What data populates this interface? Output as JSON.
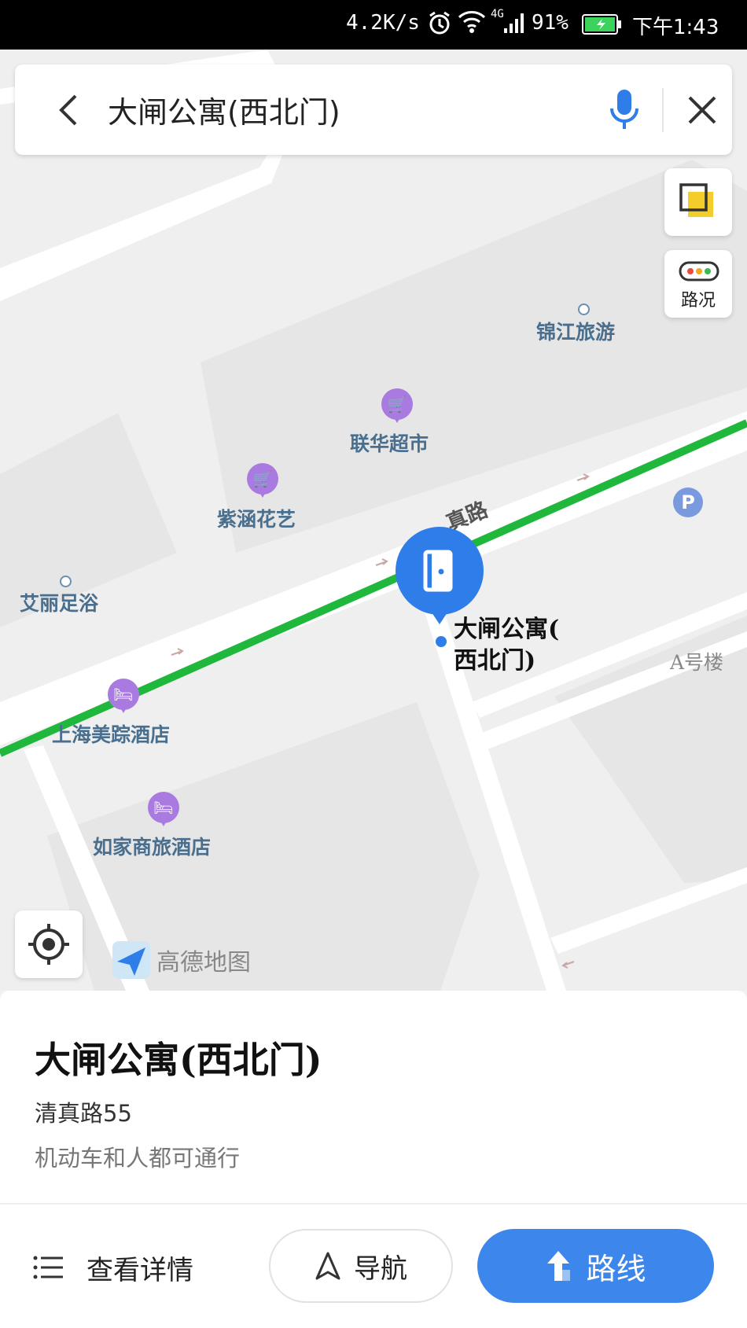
{
  "status_bar": {
    "speed": "4.2K/s",
    "network": "4G",
    "battery": "91%",
    "time": "下午1:43"
  },
  "search": {
    "query": "大闸公寓(西北门)",
    "back_icon": "chevron-left-icon",
    "mic_icon": "microphone-icon",
    "close_icon": "close-icon"
  },
  "map": {
    "layer_icon": "layers-icon",
    "traffic_label": "路况",
    "road_fragment": "真路",
    "pois": {
      "jinjiang": "锦江旅游",
      "lianhua": "联华超市",
      "zihan": "紫涵花艺",
      "aili": "艾丽足浴",
      "shanghai_hotel": "上海美踪酒店",
      "rujia": "如家商旅酒店",
      "building_a": "A号楼"
    },
    "selected_label_line1": "大闸公寓(",
    "selected_label_line2": "西北门)",
    "parking_letter": "P",
    "logo_text": "高德地图",
    "locate_icon": "crosshair-icon",
    "colors": {
      "route": "#1fb83c",
      "pin": "#2f7de8",
      "poi_pin": "#a97be0"
    }
  },
  "detail": {
    "title": "大闸公寓(西北门)",
    "address": "清真路55",
    "access": "机动车和人都可通行",
    "view_details": "查看详情",
    "navigate": "导航",
    "route": "路线"
  }
}
